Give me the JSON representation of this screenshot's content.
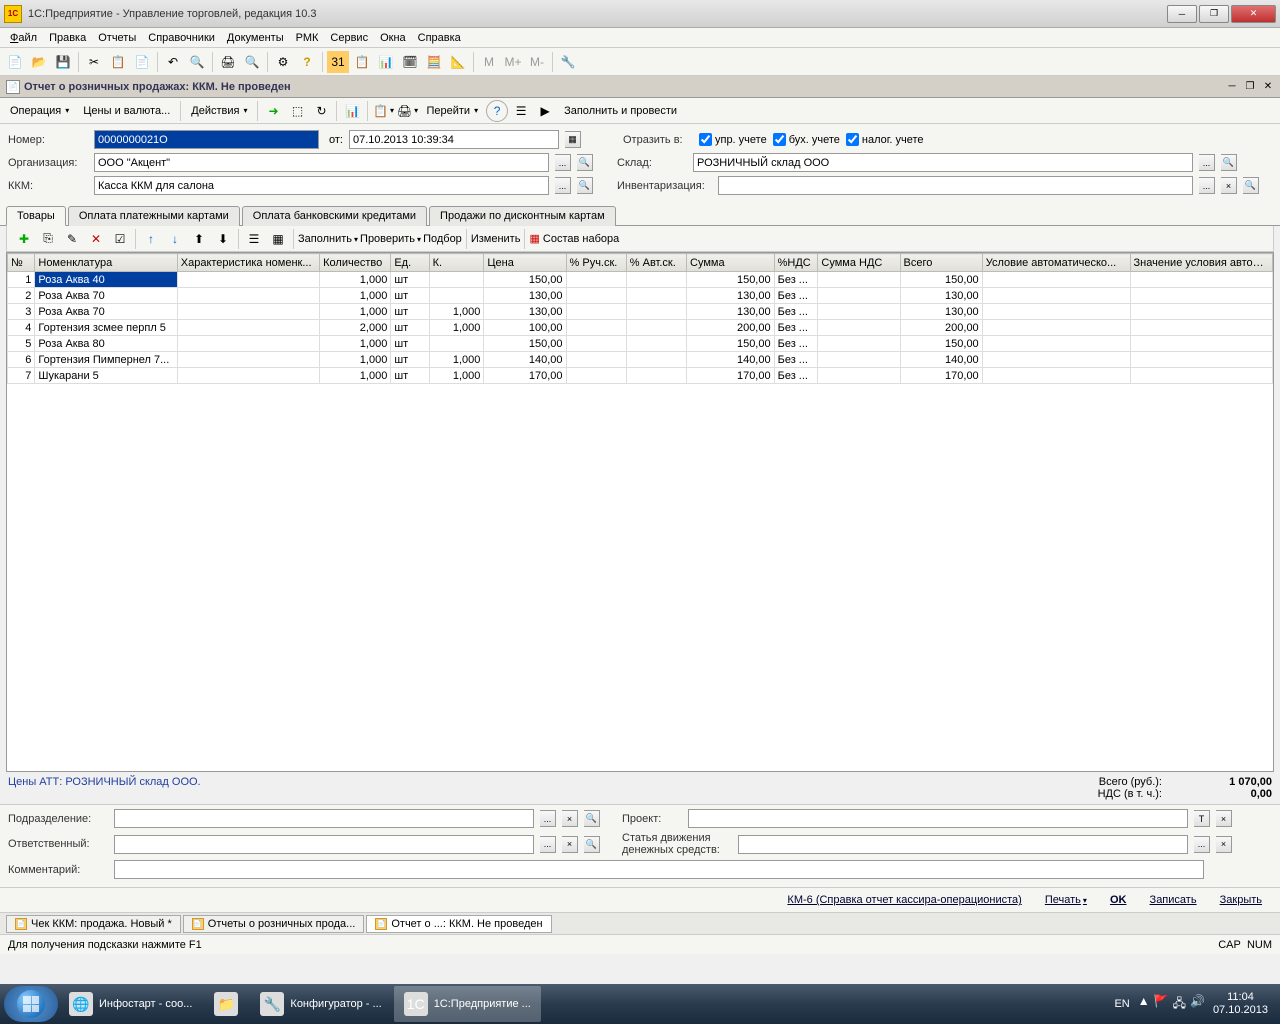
{
  "window": {
    "title": "1С:Предприятие - Управление торговлей, редакция 10.3"
  },
  "menu": [
    "Файл",
    "Правка",
    "Отчеты",
    "Справочники",
    "Документы",
    "РМК",
    "Сервис",
    "Окна",
    "Справка"
  ],
  "doc": {
    "title": "Отчет о розничных продажах: ККМ. Не проведен",
    "toolbar": {
      "operation": "Операция",
      "prices": "Цены и валюта...",
      "actions": "Действия",
      "goto": "Перейти",
      "fill_post": "Заполнить и провести"
    }
  },
  "header": {
    "number_label": "Номер:",
    "number": "0000000021О",
    "from_label": "от:",
    "date": "07.10.2013 10:39:34",
    "org_label": "Организация:",
    "org": "ООО \"Акцент\"",
    "kkm_label": "ККМ:",
    "kkm": "Касса ККМ для салона",
    "reflect_label": "Отразить в:",
    "chk1": "упр. учете",
    "chk2": "бух. учете",
    "chk3": "налог. учете",
    "sklad_label": "Склад:",
    "sklad": "РОЗНИЧНЫЙ склад ООО",
    "invent_label": "Инвентаризация:",
    "invent": ""
  },
  "tabs": [
    "Товары",
    "Оплата платежными картами",
    "Оплата банковскими кредитами",
    "Продажи по дисконтным картам"
  ],
  "grid_toolbar": {
    "fill": "Заполнить",
    "check": "Проверить",
    "podbor": "Подбор",
    "change": "Изменить",
    "sostav": "Состав набора"
  },
  "columns": [
    "№",
    "Номенклатура",
    "Характеристика номенк...",
    "Количество",
    "Ед.",
    "К.",
    "Цена",
    "% Руч.ск.",
    "% Авт.ск.",
    "Сумма",
    "%НДС",
    "Сумма НДС",
    "Всего",
    "Условие автоматическо...",
    "Значение условия автом..."
  ],
  "rows": [
    {
      "n": "1",
      "nom": "Роза  Аква 40",
      "qty": "1,000",
      "ed": "шт",
      "k": "",
      "price": "150,00",
      "sum": "150,00",
      "nds": "Без ...",
      "total": "150,00",
      "sel": true
    },
    {
      "n": "2",
      "nom": "Роза  Аква 70",
      "qty": "1,000",
      "ed": "шт",
      "k": "",
      "price": "130,00",
      "sum": "130,00",
      "nds": "Без ...",
      "total": "130,00"
    },
    {
      "n": "3",
      "nom": "Роза  Аква 70",
      "qty": "1,000",
      "ed": "шт",
      "k": "1,000",
      "price": "130,00",
      "sum": "130,00",
      "nds": "Без ...",
      "total": "130,00"
    },
    {
      "n": "4",
      "nom": "Гортензия зсмее перпл 5",
      "qty": "2,000",
      "ed": "шт",
      "k": "1,000",
      "price": "100,00",
      "sum": "200,00",
      "nds": "Без ...",
      "total": "200,00"
    },
    {
      "n": "5",
      "nom": "Роза  Аква 80",
      "qty": "1,000",
      "ed": "шт",
      "k": "",
      "price": "150,00",
      "sum": "150,00",
      "nds": "Без ...",
      "total": "150,00"
    },
    {
      "n": "6",
      "nom": "Гортензия Пимпернел 7...",
      "qty": "1,000",
      "ed": "шт",
      "k": "1,000",
      "price": "140,00",
      "sum": "140,00",
      "nds": "Без ...",
      "total": "140,00"
    },
    {
      "n": "7",
      "nom": "Шукарани 5",
      "qty": "1,000",
      "ed": "шт",
      "k": "1,000",
      "price": "170,00",
      "sum": "170,00",
      "nds": "Без ...",
      "total": "170,00"
    }
  ],
  "footer": {
    "prices": "Цены АТТ: РОЗНИЧНЫЙ склад ООО.",
    "total_label": "Всего (руб.):",
    "total": "1 070,00",
    "nds_label": "НДС (в т. ч.):",
    "nds": "0,00"
  },
  "bottom": {
    "podr_label": "Подразделение:",
    "otv_label": "Ответственный:",
    "kom_label": "Комментарий:",
    "proj_label": "Проект:",
    "stat_label": "Статья движения денежных средств:"
  },
  "actions": {
    "km6": "КМ-6 (Справка отчет кассира-операциониста)",
    "print": "Печать",
    "ok": "OK",
    "save": "Записать",
    "close": "Закрыть"
  },
  "mdi": [
    {
      "label": "Чек ККМ: продажа. Новый *"
    },
    {
      "label": "Отчеты о розничных прода..."
    },
    {
      "label": "Отчет о ...: ККМ. Не проведен",
      "active": true
    }
  ],
  "status": {
    "hint": "Для получения подсказки нажмите F1",
    "cap": "CAP",
    "num": "NUM"
  },
  "taskbar": {
    "items": [
      {
        "label": "Инфостарт - соо...",
        "icon": "chrome"
      },
      {
        "label": "",
        "icon": "explorer"
      },
      {
        "label": "Конфигуратор - ...",
        "icon": "1c-conf"
      },
      {
        "label": "1С:Предприятие ...",
        "icon": "1c",
        "active": true
      }
    ],
    "lang": "EN",
    "time": "11:04",
    "date": "07.10.2013"
  }
}
